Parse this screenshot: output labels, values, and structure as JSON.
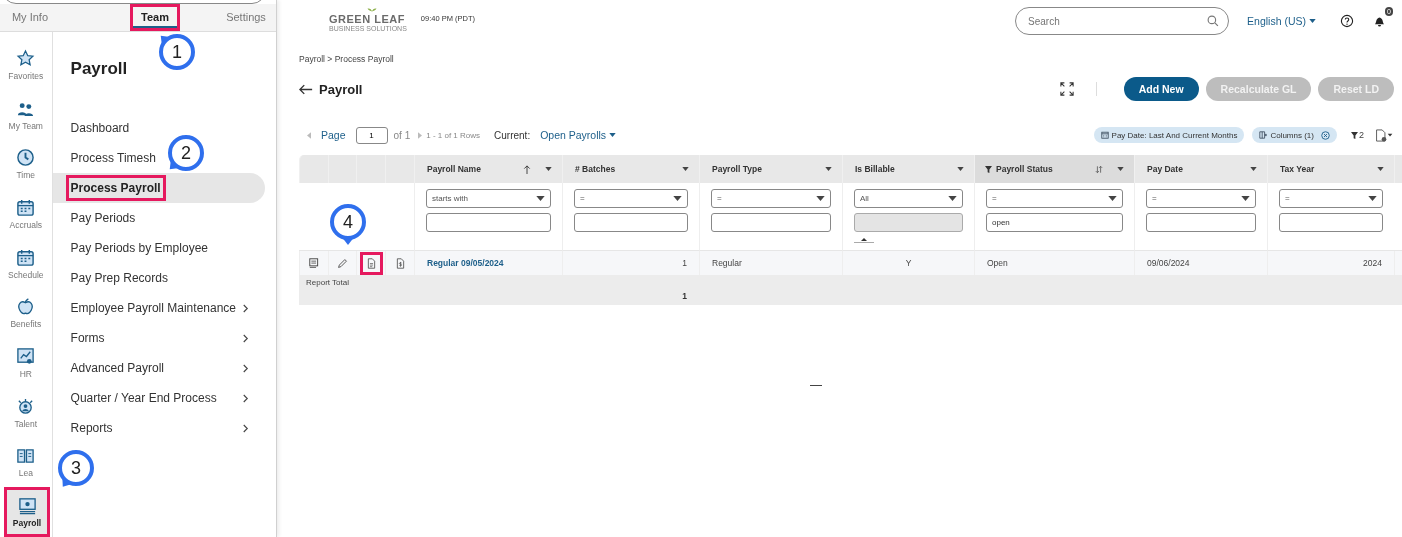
{
  "top_tabs": [
    {
      "label": "My Info",
      "selected": false,
      "highlighted": false
    },
    {
      "label": "Team",
      "selected": true,
      "highlighted": true
    },
    {
      "label": "Settings",
      "selected": false,
      "highlighted": false
    }
  ],
  "rail": [
    {
      "kind": "star",
      "label": "Favorites",
      "selected": false,
      "highlighted": false
    },
    {
      "kind": "team",
      "label": "My Team",
      "selected": false,
      "highlighted": false
    },
    {
      "kind": "clock",
      "label": "Time",
      "selected": false,
      "highlighted": false
    },
    {
      "kind": "calendar",
      "label": "Accruals",
      "selected": false,
      "highlighted": false
    },
    {
      "kind": "schedule",
      "label": "Schedule",
      "selected": false,
      "highlighted": false
    },
    {
      "kind": "apple",
      "label": "Benefits",
      "selected": false,
      "highlighted": false
    },
    {
      "kind": "chart",
      "label": "HR",
      "selected": false,
      "highlighted": false
    },
    {
      "kind": "person",
      "label": "Talent",
      "selected": false,
      "highlighted": false
    },
    {
      "kind": "book",
      "label": "Lea",
      "selected": false,
      "highlighted": false
    },
    {
      "kind": "monitor",
      "label": "Payroll",
      "selected": true,
      "highlighted": true
    }
  ],
  "menu": {
    "title": "Payroll",
    "items": [
      {
        "label": "Dashboard",
        "selected": false,
        "submenu": false,
        "highlighted": false
      },
      {
        "label": "Process Timesh",
        "selected": false,
        "submenu": false,
        "highlighted": false
      },
      {
        "label": "Process Payroll",
        "selected": true,
        "submenu": false,
        "highlighted": true
      },
      {
        "label": "Pay Periods",
        "selected": false,
        "submenu": false,
        "highlighted": false
      },
      {
        "label": "Pay Periods by Employee",
        "selected": false,
        "submenu": false,
        "highlighted": false
      },
      {
        "label": "Pay Prep Records",
        "selected": false,
        "submenu": false,
        "highlighted": false
      },
      {
        "label": "Employee Payroll Maintenance",
        "selected": false,
        "submenu": true,
        "highlighted": false
      },
      {
        "label": "Forms",
        "selected": false,
        "submenu": true,
        "highlighted": false
      },
      {
        "label": "Advanced Payroll",
        "selected": false,
        "submenu": true,
        "highlighted": false
      },
      {
        "label": "Quarter / Year End Process",
        "selected": false,
        "submenu": true,
        "highlighted": false
      },
      {
        "label": "Reports",
        "selected": false,
        "submenu": true,
        "highlighted": false
      }
    ]
  },
  "header": {
    "logo_name": "GREEN LEAF",
    "logo_tagline": "BUSINESS SOLUTIONS",
    "time": "09:40 PM (PDT)",
    "search": {
      "placeholder": "Search"
    },
    "language": "English (US)",
    "notification_count": "0"
  },
  "breadcrumb": "Payroll > Process Payroll",
  "page_title": "Payroll",
  "buttons": [
    {
      "label": "Add New",
      "disabled": false
    },
    {
      "label": "Recalculate GL",
      "disabled": true
    },
    {
      "label": "Reset LD",
      "disabled": true
    }
  ],
  "pager": {
    "page_label": "Page",
    "page": "1",
    "of": "of 1",
    "rows": "1 - 1 of 1 Rows",
    "current_label": "Current:",
    "current": "Open Payrolls"
  },
  "chips": [
    {
      "kind": "calendar",
      "label": "Pay Date: Last And Current Months",
      "removable": false
    },
    {
      "kind": "columns",
      "label": "Columns (1)",
      "removable": true
    }
  ],
  "filter_count": "2",
  "table": {
    "columns": [
      {
        "label": "Payroll Name",
        "sorted_asc": true,
        "sort_toggle": false,
        "filtered": false
      },
      {
        "label": "# Batches",
        "sorted_asc": false,
        "sort_toggle": false,
        "filtered": false
      },
      {
        "label": "Payroll Type",
        "sorted_asc": false,
        "sort_toggle": false,
        "filtered": false
      },
      {
        "label": "Is Billable",
        "sorted_asc": false,
        "sort_toggle": false,
        "filtered": false
      },
      {
        "label": "Payroll Status",
        "sorted_asc": false,
        "sort_toggle": true,
        "filtered": true
      },
      {
        "label": "Pay Date",
        "sorted_asc": false,
        "sort_toggle": false,
        "filtered": false
      },
      {
        "label": "Tax Year",
        "sorted_asc": false,
        "sort_toggle": false,
        "filtered": false
      }
    ],
    "filters": [
      {
        "operator": "starts with",
        "disabled": false
      },
      {
        "operator": "=",
        "disabled": false
      },
      {
        "operator": "=",
        "disabled": false
      },
      {
        "operator": "All",
        "disabled": true
      },
      {
        "operator": "=",
        "value": "open",
        "disabled": false
      },
      {
        "operator": "=",
        "disabled": false
      },
      {
        "operator": "=",
        "disabled": false
      }
    ],
    "row_actions": [
      {
        "kind": "report",
        "highlighted": false
      },
      {
        "kind": "edit",
        "highlighted": false
      },
      {
        "kind": "document",
        "highlighted": true
      },
      {
        "kind": "money",
        "highlighted": false
      }
    ],
    "rows": [
      {
        "cells": [
          "Regular 09/05/2024",
          "1",
          "Regular",
          "Y",
          "Open",
          "09/06/2024",
          "2024"
        ]
      }
    ],
    "total": {
      "label": "Report Total",
      "batches": "1"
    }
  },
  "callouts": [
    {
      "label": "1"
    },
    {
      "label": "2"
    },
    {
      "label": "3"
    },
    {
      "label": "4"
    }
  ]
}
